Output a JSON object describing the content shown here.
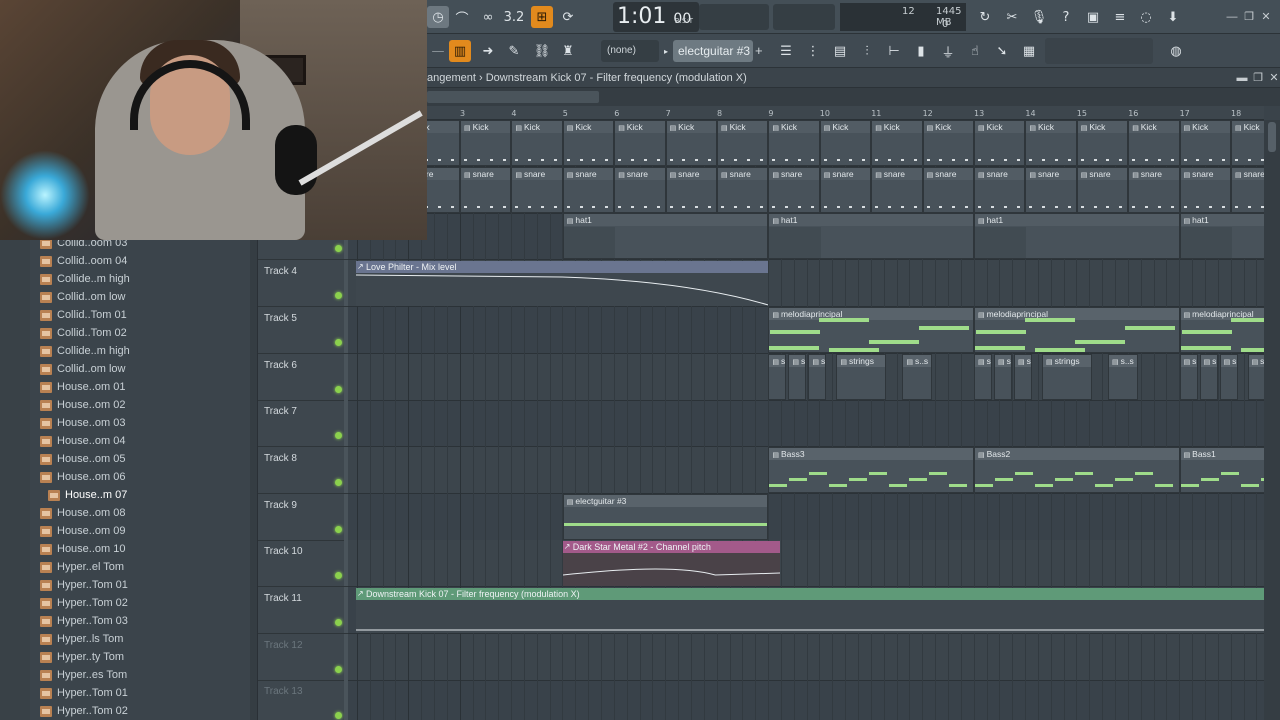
{
  "toolbar": {
    "time_display": "1:01",
    "time_frames": "00",
    "time_unit": "B:S:T",
    "cpu_value": "12",
    "ram_value": "1445 MB",
    "poly_value": "0",
    "pattern_selector": "(none)",
    "pattern_name": "electguitar #3",
    "pattern_add": "+"
  },
  "playlist": {
    "title": "angement › Downstream Kick 07 - Filter frequency (modulation X)",
    "ruler": [
      "3",
      "4",
      "5",
      "6",
      "7",
      "8",
      "9",
      "10",
      "11",
      "12",
      "13",
      "14",
      "15",
      "16",
      "17",
      "18"
    ]
  },
  "browser": {
    "items": [
      "Collid..oom 03",
      "Collid..oom 04",
      "Collide..m high",
      "Collid..om low",
      "Collid..Tom 01",
      "Collid..Tom 02",
      "Collide..m high",
      "Collid..om low",
      "House..om 01",
      "House..om 02",
      "House..om 03",
      "House..om 04",
      "House..om 05",
      "House..om 06",
      "House..m 07",
      "House..om 08",
      "House..om 09",
      "House..om 10",
      "Hyper..el Tom",
      "Hyper..Tom 01",
      "Hyper..Tom 02",
      "Hyper..Tom 03",
      "Hyper..ls Tom",
      "Hyper..ty Tom",
      "Hyper..es Tom",
      "Hyper..Tom 01",
      "Hyper..Tom 02"
    ],
    "selected_index": 14
  },
  "tracks": [
    {
      "name": "",
      "dim": false
    },
    {
      "name": "",
      "dim": false
    },
    {
      "name": "",
      "dim": false
    },
    {
      "name": "Track 4",
      "dim": false
    },
    {
      "name": "Track 5",
      "dim": false
    },
    {
      "name": "Track 6",
      "dim": false
    },
    {
      "name": "Track 7",
      "dim": false
    },
    {
      "name": "Track 8",
      "dim": false
    },
    {
      "name": "Track 9",
      "dim": false
    },
    {
      "name": "Track 10",
      "dim": false
    },
    {
      "name": "Track 11",
      "dim": false
    },
    {
      "name": "Track 12",
      "dim": true
    },
    {
      "name": "Track 13",
      "dim": true
    }
  ],
  "clips": {
    "kick": "Kick",
    "kick_partial": "ck",
    "snare": "snare",
    "snare_partial": "are",
    "hat": "hat1",
    "auto4": "Love Philter - Mix level",
    "melodia": "melodiaprincipal",
    "strings": "strings",
    "strings_short": "s..s",
    "bass3": "Bass3",
    "bass2": "Bass2",
    "bass1": "Bass1",
    "guitar": "electguitar #3",
    "auto10": "Dark Star Metal #2 - Channel pitch",
    "auto11": "Downstream Kick 07 - Filter frequency (modulation X)"
  },
  "colors": {
    "accent": "#e28a1d",
    "led": "#8bd14d",
    "note_green": "#9fdc8a",
    "auto4": "#6a7590",
    "auto10": "#a35a8a",
    "auto11": "#5f9a78"
  }
}
